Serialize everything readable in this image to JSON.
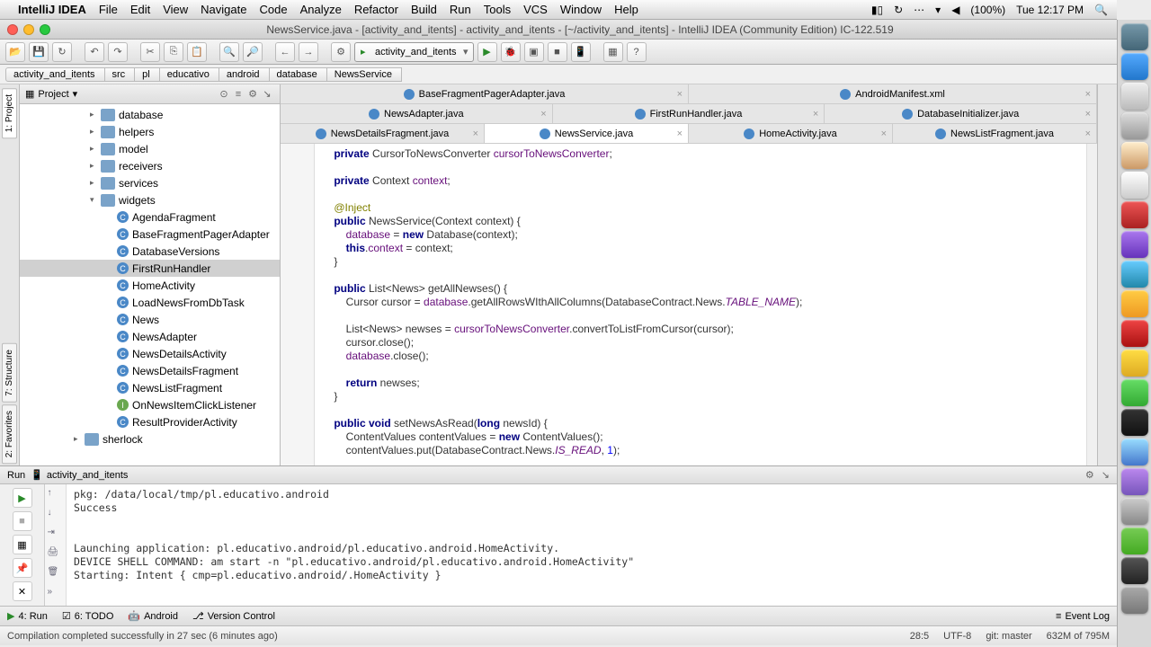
{
  "menubar": {
    "app": "IntelliJ IDEA",
    "items": [
      "File",
      "Edit",
      "View",
      "Navigate",
      "Code",
      "Analyze",
      "Refactor",
      "Build",
      "Run",
      "Tools",
      "VCS",
      "Window",
      "Help"
    ],
    "battery": "(100%)",
    "clock": "Tue 12:17 PM"
  },
  "window": {
    "title": "NewsService.java - [activity_and_itents] - activity_and_itents - [~/activity_and_itents] - IntelliJ IDEA (Community Edition) IC-122.519"
  },
  "toolbar": {
    "runConfig": "activity_and_itents"
  },
  "breadcrumb": [
    "activity_and_itents",
    "src",
    "pl",
    "educativo",
    "android",
    "database",
    "NewsService"
  ],
  "sidebar": {
    "title": "Project",
    "tabs": [
      "1: Project",
      "7: Structure",
      "2: Favorites"
    ]
  },
  "tree": [
    {
      "type": "folder",
      "label": "database",
      "level": 1,
      "arrow": "▸"
    },
    {
      "type": "folder",
      "label": "helpers",
      "level": 1,
      "arrow": "▸"
    },
    {
      "type": "folder",
      "label": "model",
      "level": 1,
      "arrow": "▸"
    },
    {
      "type": "folder",
      "label": "receivers",
      "level": 1,
      "arrow": "▸"
    },
    {
      "type": "folder",
      "label": "services",
      "level": 1,
      "arrow": "▸"
    },
    {
      "type": "folder",
      "label": "widgets",
      "level": 1,
      "arrow": "▾"
    },
    {
      "type": "class",
      "label": "AgendaFragment",
      "level": 2
    },
    {
      "type": "class",
      "label": "BaseFragmentPagerAdapter",
      "level": 2
    },
    {
      "type": "class",
      "label": "DatabaseVersions",
      "level": 2
    },
    {
      "type": "class",
      "label": "FirstRunHandler",
      "level": 2,
      "selected": true
    },
    {
      "type": "class",
      "label": "HomeActivity",
      "level": 2
    },
    {
      "type": "class",
      "label": "LoadNewsFromDbTask",
      "level": 2
    },
    {
      "type": "class",
      "label": "News",
      "level": 2
    },
    {
      "type": "class",
      "label": "NewsAdapter",
      "level": 2
    },
    {
      "type": "class",
      "label": "NewsDetailsActivity",
      "level": 2
    },
    {
      "type": "class",
      "label": "NewsDetailsFragment",
      "level": 2
    },
    {
      "type": "class",
      "label": "NewsListFragment",
      "level": 2
    },
    {
      "type": "iface",
      "label": "OnNewsItemClickListener",
      "level": 2
    },
    {
      "type": "class",
      "label": "ResultProviderActivity",
      "level": 2
    },
    {
      "type": "folder",
      "label": "sherlock",
      "level": 0,
      "arrow": "▸"
    }
  ],
  "editorTabs": [
    [
      "BaseFragmentPagerAdapter.java",
      "AndroidManifest.xml"
    ],
    [
      "NewsAdapter.java",
      "FirstRunHandler.java",
      "DatabaseInitializer.java"
    ],
    [
      "NewsDetailsFragment.java",
      "NewsService.java",
      "HomeActivity.java",
      "NewsListFragment.java"
    ]
  ],
  "activeTab": "NewsService.java",
  "code": {
    "l1a": "    private",
    "l1b": " CursorToNewsConverter ",
    "l1c": "cursorToNewsConverter",
    "l1d": ";",
    "l3a": "    private",
    "l3b": " Context ",
    "l3c": "context",
    "l3d": ";",
    "l5a": "    @Inject",
    "l6a": "    public",
    "l6b": " NewsService(Context context) {",
    "l7a": "        database",
    "l7b": " = ",
    "l7c": "new",
    "l7d": " Database(context);",
    "l8a": "        this",
    "l8b": ".",
    "l8c": "context",
    "l8d": " = context;",
    "l9": "    }",
    "l11a": "    public",
    "l11b": " List<News> getAllNewses() {",
    "l12a": "        Cursor cursor = ",
    "l12b": "database",
    "l12c": ".getAllRowsWIthAllColumns(DatabaseContract.News.",
    "l12d": "TABLE_NAME",
    "l12e": ");",
    "l14a": "        List<News> newses = ",
    "l14b": "cursorToNewsConverter",
    "l14c": ".convertToListFromCursor(cursor);",
    "l15": "        cursor.close();",
    "l16a": "        database",
    "l16b": ".close();",
    "l18a": "        return",
    "l18b": " newses;",
    "l19": "    }",
    "l21a": "    public void",
    "l21b": " setNewsAsRead(",
    "l21c": "long",
    "l21d": " newsId) {",
    "l22a": "        ContentValues contentValues = ",
    "l22b": "new",
    "l22c": " ContentValues();",
    "l23a": "        contentValues.put(DatabaseContract.News.",
    "l23b": "IS_READ",
    "l23c": ", ",
    "l23d": "1",
    "l23e": ");"
  },
  "run": {
    "header": "Run",
    "config": "activity_and_itents",
    "console": "pkg: /data/local/tmp/pl.educativo.android\nSuccess\n\n\nLaunching application: pl.educativo.android/pl.educativo.android.HomeActivity.\nDEVICE SHELL COMMAND: am start -n \"pl.educativo.android/pl.educativo.android.HomeActivity\"\nStarting: Intent { cmp=pl.educativo.android/.HomeActivity }"
  },
  "bottom": {
    "run": "4: Run",
    "todo": "6: TODO",
    "android": "Android",
    "vcs": "Version Control",
    "eventlog": "Event Log"
  },
  "status": {
    "msg": "Compilation completed successfully in 27 sec (6 minutes ago)",
    "pos": "28:5",
    "enc": "UTF-8",
    "git": "git: master",
    "mem": "632M of 795M"
  }
}
